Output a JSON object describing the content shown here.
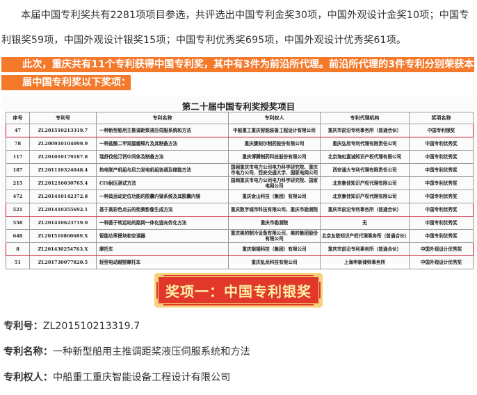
{
  "intro": {
    "para1": "本届中国专利奖共有2281项项目参选，共评选出中国专利金奖30项，中国外观设计金奖10项；中国专利银奖59项，中国外观设计银奖15项；中国专利优秀奖695项，中国外观设计优秀奖61项。",
    "highlight": "此次，重庆共有11个专利获得中国专利奖，其中有3件为前沿所代理。前沿所代理的3件专利分别荣获本届中国专利奖以下奖项："
  },
  "table": {
    "title": "第二十届中国专利奖授奖项目",
    "headers": [
      "序号",
      "专利号",
      "专利名称",
      "专利权人",
      "专利代理机构",
      "奖项名称"
    ],
    "rows": [
      {
        "no": "47",
        "patent_no": "ZL201510213319.7",
        "name": "一种新型船用主推调距桨液压伺服系统和方法",
        "owner": "中船重工重庆智能装备工程设计有限公司",
        "agency": "重庆市前沿专利事务所（普通合伙）",
        "award": "中国专利银奖",
        "marked": true
      },
      {
        "no": "78",
        "patent_no": "ZL200910104099.9",
        "name": "一种盐酸二甲双胍缓释片及其制备方法",
        "owner": "重庆康刻尔制药股份有限公司",
        "agency": "重庆弘旭专利代理有限责任公司",
        "award": "中国专利优秀奖",
        "marked": false
      },
      {
        "no": "117",
        "patent_no": "ZL201010179187.8",
        "name": "瑞舒伐他汀钙中间体及制备方法",
        "owner": "重庆博腾制药科技股份有限公司",
        "agency": "北京海虹嘉诚知识产权代理有限公司",
        "award": "中国专利优秀奖",
        "marked": false
      },
      {
        "no": "187",
        "patent_no": "ZL201110324048.4",
        "name": "热电联产机组与风力发电机组协调及储能方法",
        "owner": "国网重庆市电力公司电力科学研究院、重庆市电力公司、西安交通大学、国家电网公司",
        "agency": "西安通大专利代理有限责任公司",
        "award": "中国专利优秀奖",
        "marked": false
      },
      {
        "no": "215",
        "patent_no": "ZL201210030765.4",
        "name": "CIS耐压测试方法",
        "owner": "国网重庆市电力公司电力科学研究院、国家电网公司",
        "agency": "北京集佳知识产权代理有限公司",
        "award": "中国专利优秀奖",
        "marked": false
      },
      {
        "no": "472",
        "patent_no": "ZL201410142372.8",
        "name": "一种具运动定位功能的胶囊内镜系统及其胶囊内镜",
        "owner": "重庆金山科技（集团）有限公司",
        "agency": "北京集佳知识产权代理有限公司",
        "award": "中国专利优秀奖",
        "marked": false
      },
      {
        "no": "521",
        "patent_no": "ZL201410355692.1",
        "name": "基于真彩色点云的街景影像生成方法",
        "owner": "重庆数字城市科技有限公司、重庆市勘测院",
        "agency": "重庆市前沿专利事务所（普通合伙）",
        "award": "中国专利优秀奖",
        "marked": true
      },
      {
        "no": "558",
        "patent_no": "ZL201410623719.0",
        "name": "一种基于转运站的路网一体化竖向优化方法",
        "owner": "重庆市勘测院",
        "agency": "无",
        "award": "中国专利优秀奖",
        "marked": false
      },
      {
        "no": "648",
        "patent_no": "ZL201510860689.X",
        "name": "智能功率模块和空调器",
        "owner": "重庆美的制冷设备有限公司、美的集团股份有限公司",
        "agency": "北京友联知识产权代理事务所（普通合伙）",
        "award": "中国专利优秀奖",
        "marked": false
      },
      {
        "no": "8",
        "patent_no": "ZL201430254763.X",
        "name": "摩托车",
        "owner": "重庆银钢科技（集团）有限公司",
        "agency": "重庆市前沿专利事务所（普通合伙）",
        "award": "中国外观设计优秀奖",
        "marked": true
      },
      {
        "no": "51",
        "patent_no": "ZL201730077820.5",
        "name": "轻型电动越野摩托车",
        "owner": "重庆虬龙科技有限公司",
        "agency": "上海申新律师事务所",
        "award": "中国外观设计优秀奖",
        "marked": false
      }
    ]
  },
  "banner": {
    "label": "奖项一：中国专利银奖"
  },
  "details": [
    {
      "key": "专利号：",
      "value": "ZL201510213319.7"
    },
    {
      "key": "专利名称：",
      "value": "一种新型船用主推调距桨液压伺服系统和方法"
    },
    {
      "key": "专利权人：",
      "value": "中船重工重庆智能设备工程设计有限公司"
    }
  ]
}
